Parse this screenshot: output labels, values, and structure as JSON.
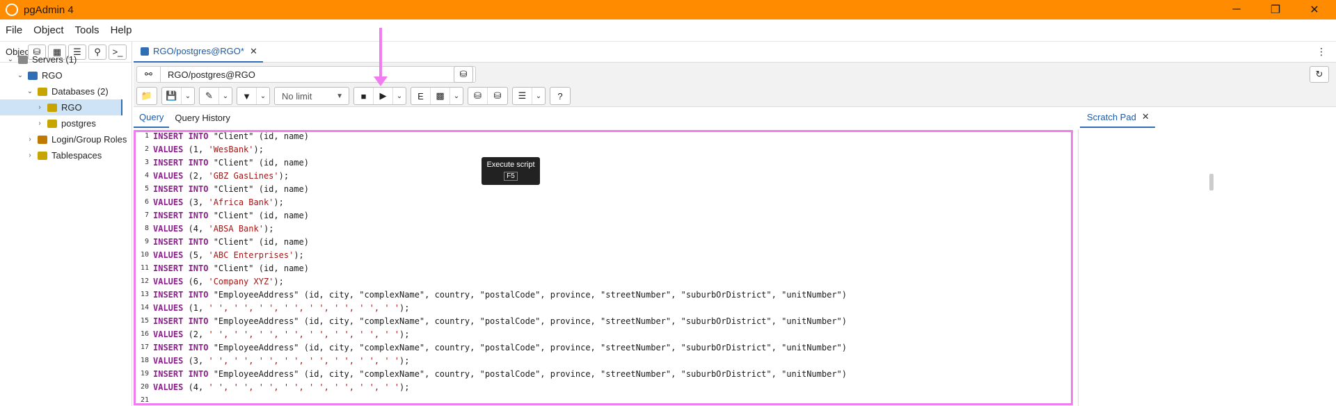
{
  "window": {
    "title": "pgAdmin 4",
    "minimize": "─",
    "maximize": "❐",
    "close": "✕"
  },
  "menubar": {
    "items": [
      "File",
      "Object",
      "Tools",
      "Help"
    ]
  },
  "browser": {
    "label": "Object Explorer",
    "label_short": "Objec",
    "tree": [
      {
        "label": "Servers (1)",
        "indent": 0,
        "chevron": "⌄"
      },
      {
        "label": "RGO",
        "indent": 1,
        "chevron": "⌄"
      },
      {
        "label": "Databases (2)",
        "indent": 2,
        "chevron": "⌄"
      },
      {
        "label": "RGO",
        "indent": 3,
        "chevron": "›",
        "selected": true
      },
      {
        "label": "postgres",
        "indent": 3,
        "chevron": "›"
      },
      {
        "label": "Login/Group Roles",
        "indent": 2,
        "chevron": "›"
      },
      {
        "label": "Tablespaces",
        "indent": 2,
        "chevron": "›"
      }
    ]
  },
  "editor_tab": {
    "label": "RGO/postgres@RGO*",
    "close": "✕"
  },
  "connection": {
    "value": "RGO/postgres@RGO"
  },
  "toolbar": {
    "limit": "No limit"
  },
  "tooltip": {
    "title": "Execute script",
    "key": "F5"
  },
  "subtabs": {
    "query": "Query",
    "history": "Query History"
  },
  "scratch": {
    "label": "Scratch Pad",
    "close": "✕"
  },
  "code_lines": [
    [
      [
        "kw",
        "INSERT INTO "
      ],
      [
        "id",
        "\"Client\" (id, name)"
      ]
    ],
    [
      [
        "kw",
        "VALUES "
      ],
      [
        "id",
        "(1, "
      ],
      [
        "str",
        "'WesBank'"
      ],
      [
        "id",
        ");"
      ]
    ],
    [
      [
        "kw",
        "INSERT INTO "
      ],
      [
        "id",
        "\"Client\" (id, name)"
      ]
    ],
    [
      [
        "kw",
        "VALUES "
      ],
      [
        "id",
        "(2, "
      ],
      [
        "str",
        "'GBZ GasLines'"
      ],
      [
        "id",
        ");"
      ]
    ],
    [
      [
        "kw",
        "INSERT INTO "
      ],
      [
        "id",
        "\"Client\" (id, name)"
      ]
    ],
    [
      [
        "kw",
        "VALUES "
      ],
      [
        "id",
        "(3, "
      ],
      [
        "str",
        "'Africa Bank'"
      ],
      [
        "id",
        ");"
      ]
    ],
    [
      [
        "kw",
        "INSERT INTO "
      ],
      [
        "id",
        "\"Client\" (id, name)"
      ]
    ],
    [
      [
        "kw",
        "VALUES "
      ],
      [
        "id",
        "(4, "
      ],
      [
        "str",
        "'ABSA Bank'"
      ],
      [
        "id",
        ");"
      ]
    ],
    [
      [
        "kw",
        "INSERT INTO "
      ],
      [
        "id",
        "\"Client\" (id, name)"
      ]
    ],
    [
      [
        "kw",
        "VALUES "
      ],
      [
        "id",
        "(5, "
      ],
      [
        "str",
        "'ABC Enterprises'"
      ],
      [
        "id",
        ");"
      ]
    ],
    [
      [
        "kw",
        "INSERT INTO "
      ],
      [
        "id",
        "\"Client\" (id, name)"
      ]
    ],
    [
      [
        "kw",
        "VALUES "
      ],
      [
        "id",
        "(6, "
      ],
      [
        "str",
        "'Company XYZ'"
      ],
      [
        "id",
        ");"
      ]
    ],
    [
      [
        "kw",
        "INSERT INTO "
      ],
      [
        "id",
        "\"EmployeeAddress\" (id, city, \"complexName\", country, \"postalCode\", province, \"streetNumber\", \"suburbOrDistrict\", \"unitNumber\")"
      ]
    ],
    [
      [
        "kw",
        "VALUES "
      ],
      [
        "id",
        "(1, "
      ],
      [
        "str",
        "' ', ' ', ' ', ' ', ' ', ' ', ' ', ' '"
      ],
      [
        "id",
        ");"
      ]
    ],
    [
      [
        "kw",
        "INSERT INTO "
      ],
      [
        "id",
        "\"EmployeeAddress\" (id, city, \"complexName\", country, \"postalCode\", province, \"streetNumber\", \"suburbOrDistrict\", \"unitNumber\")"
      ]
    ],
    [
      [
        "kw",
        "VALUES "
      ],
      [
        "id",
        "(2, "
      ],
      [
        "str",
        "' ', ' ', ' ', ' ', ' ', ' ', ' ', ' '"
      ],
      [
        "id",
        ");"
      ]
    ],
    [
      [
        "kw",
        "INSERT INTO "
      ],
      [
        "id",
        "\"EmployeeAddress\" (id, city, \"complexName\", country, \"postalCode\", province, \"streetNumber\", \"suburbOrDistrict\", \"unitNumber\")"
      ]
    ],
    [
      [
        "kw",
        "VALUES "
      ],
      [
        "id",
        "(3, "
      ],
      [
        "str",
        "' ', ' ', ' ', ' ', ' ', ' ', ' ', ' '"
      ],
      [
        "id",
        ");"
      ]
    ],
    [
      [
        "kw",
        "INSERT INTO "
      ],
      [
        "id",
        "\"EmployeeAddress\" (id, city, \"complexName\", country, \"postalCode\", province, \"streetNumber\", \"suburbOrDistrict\", \"unitNumber\")"
      ]
    ],
    [
      [
        "kw",
        "VALUES "
      ],
      [
        "id",
        "(4, "
      ],
      [
        "str",
        "' ', ' ', ' ', ' ', ' ', ' ', ' ', ' '"
      ],
      [
        "id",
        ");"
      ]
    ]
  ],
  "extra_line_numbers": [
    "21"
  ]
}
